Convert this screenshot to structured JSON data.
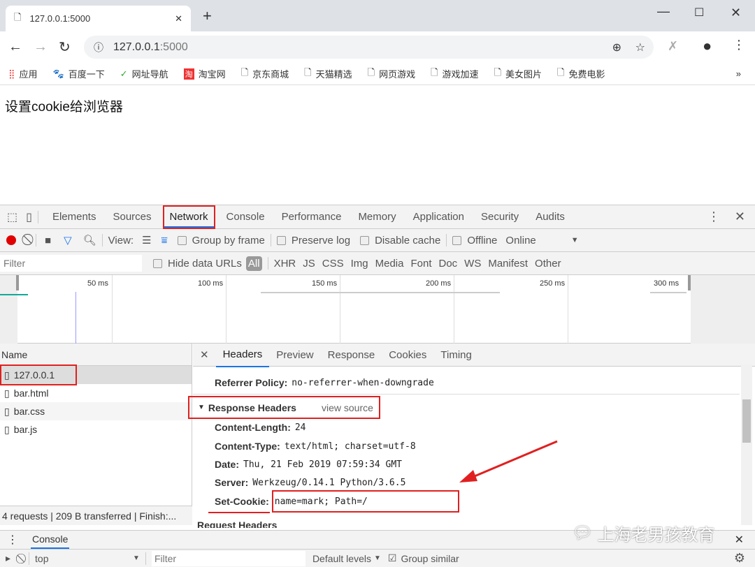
{
  "browser": {
    "tab_title": "127.0.0.1:5000",
    "new_tab": "+",
    "url_host": "127.0.0.1",
    "url_port": ":5000",
    "bookmarks": [
      "应用",
      "百度一下",
      "网址导航",
      "淘宝网",
      "京东商城",
      "天猫精选",
      "网页游戏",
      "游戏加速",
      "美女图片",
      "免费电影"
    ],
    "more": "»"
  },
  "page": {
    "text": "设置cookie给浏览器"
  },
  "devtools": {
    "tabs": [
      "Elements",
      "Sources",
      "Network",
      "Console",
      "Performance",
      "Memory",
      "Application",
      "Security",
      "Audits"
    ],
    "active_tab": "Network",
    "toolbar": {
      "view_label": "View:",
      "group_by_frame": "Group by frame",
      "preserve_log": "Preserve log",
      "disable_cache": "Disable cache",
      "offline": "Offline",
      "throttle": "Online"
    },
    "filter": {
      "placeholder": "Filter",
      "hide_data_urls": "Hide data URLs",
      "types": [
        "All",
        "XHR",
        "JS",
        "CSS",
        "Img",
        "Media",
        "Font",
        "Doc",
        "WS",
        "Manifest",
        "Other"
      ]
    },
    "timeline": {
      "ticks": [
        "50 ms",
        "100 ms",
        "150 ms",
        "200 ms",
        "250 ms",
        "300 ms"
      ]
    },
    "requests": {
      "header": "Name",
      "items": [
        "127.0.0.1",
        "bar.html",
        "bar.css",
        "bar.js"
      ],
      "status": "4 requests | 209 B transferred | Finish:..."
    },
    "detail_tabs": [
      "Headers",
      "Preview",
      "Response",
      "Cookies",
      "Timing"
    ],
    "headers": {
      "referrer_key": "Referrer Policy:",
      "referrer_val": "no-referrer-when-downgrade",
      "response_title": "Response Headers",
      "view_source": "view source",
      "rows": [
        {
          "k": "Content-Length:",
          "v": "24"
        },
        {
          "k": "Content-Type:",
          "v": "text/html; charset=utf-8"
        },
        {
          "k": "Date:",
          "v": "Thu, 21 Feb 2019 07:59:34 GMT"
        },
        {
          "k": "Server:",
          "v": "Werkzeug/0.14.1 Python/3.6.5"
        },
        {
          "k": "Set-Cookie:",
          "v": "name=mark; Path=/"
        }
      ],
      "request_title": "Request Headers"
    },
    "drawer": {
      "tab": "Console",
      "context": "top",
      "filter_placeholder": "Filter",
      "levels": "Default levels",
      "group_similar": "Group similar"
    }
  },
  "watermark": "上海老男孩教育",
  "colors": {
    "highlight": "#e02020",
    "accent": "#1a73e8",
    "record": "#e00000"
  }
}
